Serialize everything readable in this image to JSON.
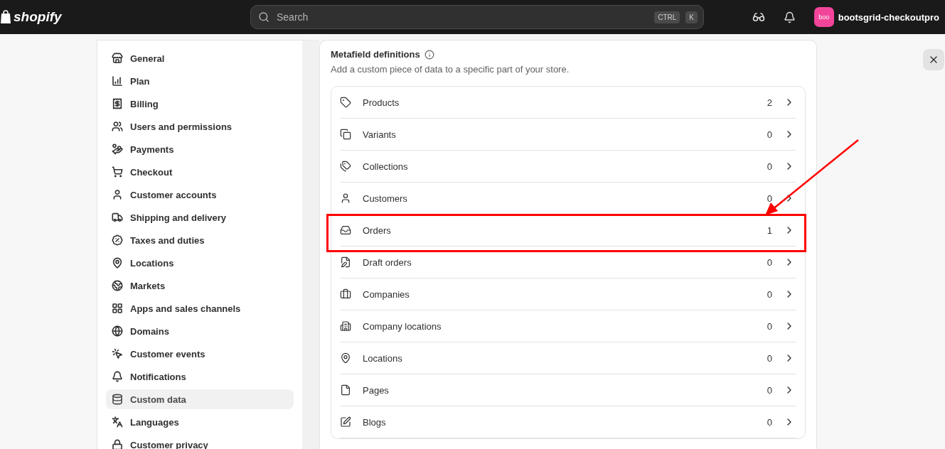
{
  "topbar": {
    "logo": "shopify",
    "search": {
      "placeholder": "Search",
      "shortcut": [
        "CTRL",
        "K"
      ]
    },
    "store": {
      "avatar": "boo",
      "name": "bootsgrid-checkoutpro"
    }
  },
  "sidebar": {
    "items": [
      {
        "label": "General",
        "selected": false
      },
      {
        "label": "Plan",
        "selected": false
      },
      {
        "label": "Billing",
        "selected": false
      },
      {
        "label": "Users and permissions",
        "selected": false
      },
      {
        "label": "Payments",
        "selected": false
      },
      {
        "label": "Checkout",
        "selected": false
      },
      {
        "label": "Customer accounts",
        "selected": false
      },
      {
        "label": "Shipping and delivery",
        "selected": false
      },
      {
        "label": "Taxes and duties",
        "selected": false
      },
      {
        "label": "Locations",
        "selected": false
      },
      {
        "label": "Markets",
        "selected": false
      },
      {
        "label": "Apps and sales channels",
        "selected": false
      },
      {
        "label": "Domains",
        "selected": false
      },
      {
        "label": "Customer events",
        "selected": false
      },
      {
        "label": "Notifications",
        "selected": false
      },
      {
        "label": "Custom data",
        "selected": true
      },
      {
        "label": "Languages",
        "selected": false
      },
      {
        "label": "Customer privacy",
        "selected": false
      }
    ]
  },
  "metafields": {
    "title": "Metafield definitions",
    "description": "Add a custom piece of data to a specific part of your store.",
    "rows": [
      {
        "label": "Products",
        "count": "2",
        "highlighted": false
      },
      {
        "label": "Variants",
        "count": "0",
        "highlighted": false
      },
      {
        "label": "Collections",
        "count": "0",
        "highlighted": false
      },
      {
        "label": "Customers",
        "count": "0",
        "highlighted": false
      },
      {
        "label": "Orders",
        "count": "1",
        "highlighted": true
      },
      {
        "label": "Draft orders",
        "count": "0",
        "highlighted": false
      },
      {
        "label": "Companies",
        "count": "0",
        "highlighted": false
      },
      {
        "label": "Company locations",
        "count": "0",
        "highlighted": false
      },
      {
        "label": "Locations",
        "count": "0",
        "highlighted": false
      },
      {
        "label": "Pages",
        "count": "0",
        "highlighted": false
      },
      {
        "label": "Blogs",
        "count": "0",
        "highlighted": false
      }
    ]
  }
}
